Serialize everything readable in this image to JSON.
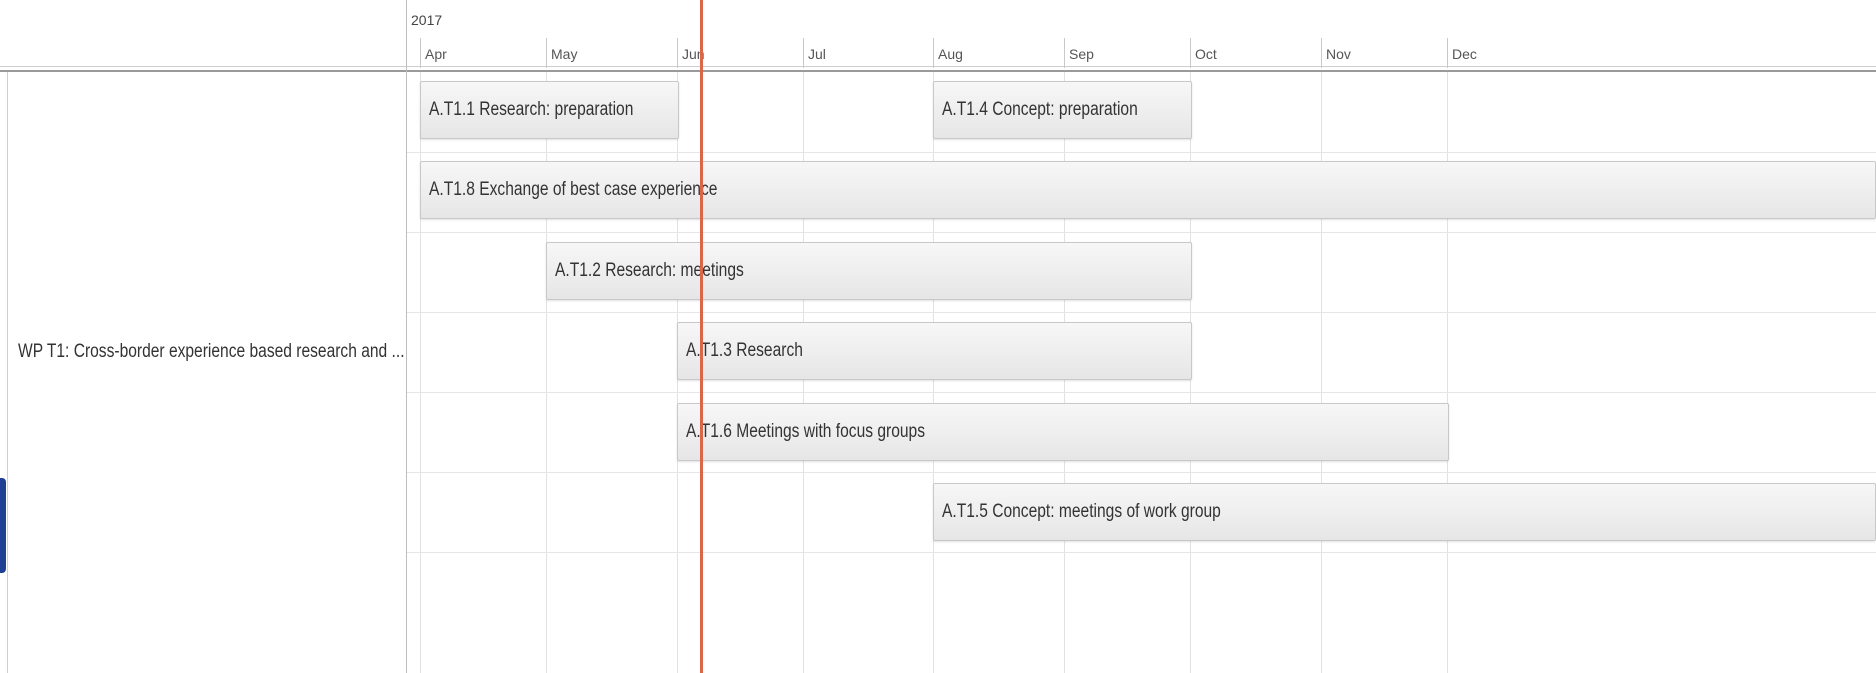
{
  "timeline": {
    "year": "2017",
    "months": [
      "Apr",
      "May",
      "Jun",
      "Jul",
      "Aug",
      "Sep",
      "Oct",
      "Nov",
      "Dec"
    ]
  },
  "work_package": {
    "label": "WP T1: Cross-border experience based research and ..."
  },
  "tasks": [
    {
      "label": "A.T1.1 Research: preparation"
    },
    {
      "label": "A.T1.4 Concept: preparation"
    },
    {
      "label": "A.T1.8 Exchange of best case experience"
    },
    {
      "label": "A.T1.2 Research: meetings"
    },
    {
      "label": "A.T1.3 Research"
    },
    {
      "label": "A.T1.6 Meetings with focus groups"
    },
    {
      "label": "A.T1.5 Concept: meetings of work group"
    }
  ],
  "colors": {
    "today_line": "#d9674a",
    "bar_fill": "#eeeeee",
    "accent_blue": "#1f3f94"
  }
}
